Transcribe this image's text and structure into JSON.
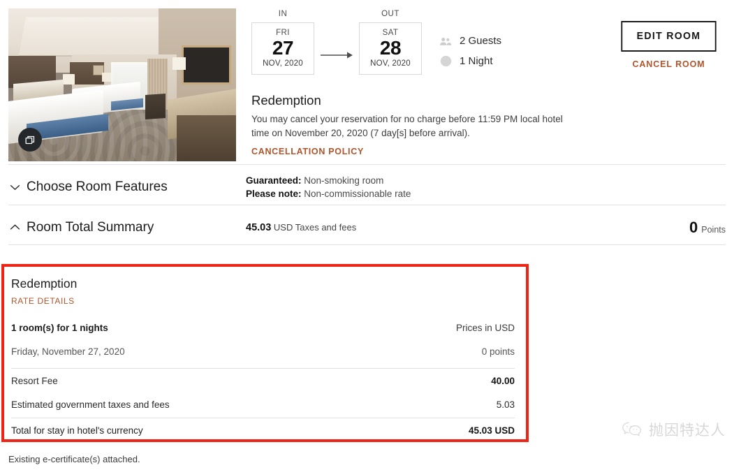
{
  "stay": {
    "check_in_label": "IN",
    "check_out_label": "OUT",
    "check_in": {
      "dow": "FRI",
      "day": "27",
      "month_year": "NOV, 2020"
    },
    "check_out": {
      "dow": "SAT",
      "day": "28",
      "month_year": "NOV, 2020"
    },
    "guests": "2 Guests",
    "nights": "1 Night",
    "guests_icon": "people-icon",
    "nights_icon": "moon-icon"
  },
  "actions": {
    "edit_room": "EDIT ROOM",
    "cancel_room": "CANCEL ROOM"
  },
  "photo": {
    "gallery_icon": "photo-stack-icon",
    "alt": "hotel-room-photo"
  },
  "redemption": {
    "title": "Redemption",
    "policy_text": "You may cancel your reservation for no charge before 11:59 PM local hotel time on November 20, 2020 (7 day[s] before arrival).",
    "policy_link": "CANCELLATION POLICY"
  },
  "features": {
    "title": "Choose Room Features",
    "chevron": "chevron-down-icon",
    "guaranteed_label": "Guaranteed:",
    "guaranteed_value": "Non-smoking room",
    "note_label": "Please note:",
    "note_value": "Non-commissionable rate"
  },
  "summary": {
    "title": "Room Total Summary",
    "chevron": "chevron-up-icon",
    "amount": "45.03",
    "amount_suffix": "USD Taxes and fees",
    "points_value": "0",
    "points_label": "Points"
  },
  "rate_details": {
    "title": "Redemption",
    "link": "RATE DETAILS",
    "rooms_nights": "1 room(s) for 1 nights",
    "prices_in": "Prices in USD",
    "date": "Friday, November 27, 2020",
    "date_points": "0 points",
    "lines": [
      {
        "label": "Resort Fee",
        "value": "40.00"
      },
      {
        "label": "Estimated government taxes and fees",
        "value": "5.03"
      }
    ],
    "total_label": "Total for stay in hotel's currency",
    "total_value": "45.03 USD"
  },
  "footer": {
    "note": "Existing e-certificate(s) attached."
  },
  "watermark": {
    "icon": "wechat-icon",
    "text": "抛因特达人"
  },
  "colors": {
    "accent_link": "#b0542b",
    "highlight_border": "#ee2417",
    "text_primary": "#1a1a1a"
  }
}
